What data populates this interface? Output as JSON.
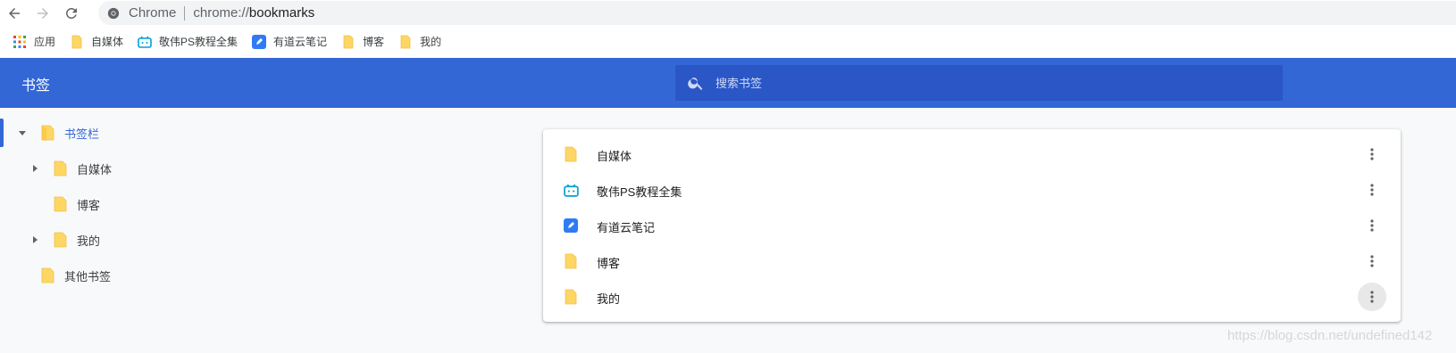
{
  "browser": {
    "omnibox": {
      "site_label": "Chrome",
      "url_scheme": "chrome://",
      "url_host": "bookmarks"
    }
  },
  "bookmarks_bar": {
    "items": [
      {
        "label": "应用",
        "icon": "apps-grid-icon"
      },
      {
        "label": "自媒体",
        "icon": "folder-icon"
      },
      {
        "label": "敬伟PS教程全集",
        "icon": "bilibili-icon"
      },
      {
        "label": "有道云笔记",
        "icon": "youdao-note-icon"
      },
      {
        "label": "博客",
        "icon": "folder-icon"
      },
      {
        "label": "我的",
        "icon": "folder-icon"
      }
    ]
  },
  "header": {
    "title": "书签",
    "search_placeholder": "搜索书签"
  },
  "sidebar": {
    "items": [
      {
        "label": "书签栏",
        "expanded": true,
        "selected": true
      },
      {
        "label": "自媒体",
        "collapsed": true
      },
      {
        "label": "博客"
      },
      {
        "label": "我的",
        "collapsed": true
      },
      {
        "label": "其他书签"
      }
    ]
  },
  "list": {
    "rows": [
      {
        "label": "自媒体",
        "icon": "folder-icon"
      },
      {
        "label": "敬伟PS教程全集",
        "icon": "bilibili-icon"
      },
      {
        "label": "有道云笔记",
        "icon": "youdao-note-icon"
      },
      {
        "label": "博客",
        "icon": "folder-icon"
      },
      {
        "label": "我的",
        "icon": "folder-icon"
      }
    ]
  },
  "watermark": "https://blog.csdn.net/undefined142",
  "colors": {
    "accent": "#3367d6",
    "search_bg": "#2a56c6",
    "folder": "#fdd663"
  }
}
